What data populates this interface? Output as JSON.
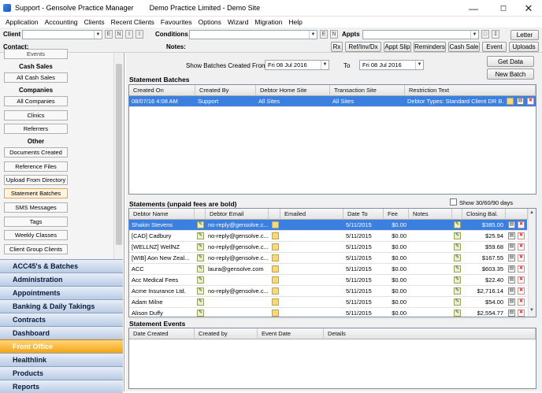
{
  "window": {
    "title": "Support - Gensolve Practice Manager",
    "company": "Demo Practice Limited - Demo Site"
  },
  "menu": [
    "Application",
    "Accounting",
    "Clients",
    "Recent Clients",
    "Favourites",
    "Options",
    "Wizard",
    "Migration",
    "Help"
  ],
  "toolbar": {
    "client_label": "Client",
    "conditions_label": "Conditions",
    "appts_label": "Appts",
    "contact_label": "Contact:",
    "notes_label": "Notes:",
    "letter": "Letter",
    "mini": {
      "e": "E",
      "n": "N",
      "i": "I"
    },
    "buttons": [
      "Rx",
      "Ref/Inv/Dx",
      "Appt Slip",
      "Reminders",
      "Cash Sale",
      "Event",
      "Uploads"
    ]
  },
  "sidebar": {
    "events_label": "Events",
    "cash_sales_head": "Cash Sales",
    "all_cash_sales": "All Cash Sales",
    "companies_head": "Companies",
    "all_companies": "All Companies",
    "clinics": "Clinics",
    "referrers": "Referrers",
    "other_head": "Other",
    "other_items": [
      "Documents Created",
      "Reference Files",
      "Upload From Directory",
      "Statement Batches",
      "SMS Messages",
      "Tags",
      "Weekly Classes",
      "Client Group Clients"
    ],
    "nav": [
      "ACC45's & Batches",
      "Administration",
      "Appointments",
      "Banking & Daily Takings",
      "Contracts",
      "Dashboard",
      "Front Office",
      "Healthlink",
      "Products",
      "Reports"
    ]
  },
  "batches": {
    "show_label": "Show Batches Created From",
    "from": "Fri  08  Jul  2016",
    "to_label": "To",
    "to": "Fri  08  Jul  2016",
    "get_data": "Get Data",
    "new_batch": "New Batch",
    "section": "Statement Batches",
    "headers": [
      "Created On",
      "Created By",
      "Debtor Home Site",
      "Transaction Site",
      "Restriction Text"
    ],
    "row": [
      "08/07/16 4:08 AM",
      "Support",
      "All Sites",
      "All Sites",
      "Debtor Types: Standard Client DR B..."
    ]
  },
  "statements": {
    "section": "Statements (unpaid fees are bold)",
    "show_aging": "Show 30/60/90 days",
    "headers": [
      "Debtor Name",
      "Debtor Email",
      "Emailed",
      "Date To",
      "Fee",
      "Notes",
      "Closing Bal."
    ],
    "rows": [
      {
        "name": "Shakin Stevens",
        "email": "no-reply@gensolve.c...",
        "date": "5/11/2015",
        "fee": "$0.00",
        "bal": "$385.00"
      },
      {
        "name": "[CAD] Cadbury",
        "email": "no-reply@gensolve.c...",
        "date": "5/11/2015",
        "fee": "$0.00",
        "bal": "$25.94"
      },
      {
        "name": "[WELLNZ] WellNZ",
        "email": "no-reply@gensolve.c...",
        "date": "5/11/2015",
        "fee": "$0.00",
        "bal": "$59.68"
      },
      {
        "name": "[WIB] Aon New Zeal...",
        "email": "no-reply@gensolve.c...",
        "date": "5/11/2015",
        "fee": "$0.00",
        "bal": "$167.55"
      },
      {
        "name": "ACC",
        "email": "laura@gensolve.com",
        "date": "5/11/2015",
        "fee": "$0.00",
        "bal": "$603.35"
      },
      {
        "name": "Acc Medical Fees",
        "email": "",
        "date": "5/11/2015",
        "fee": "$0.00",
        "bal": "$22.40"
      },
      {
        "name": "Acme Insurance Ltd.",
        "email": "no-reply@gensolve.c...",
        "date": "5/11/2015",
        "fee": "$0.00",
        "bal": "$2,716.14"
      },
      {
        "name": "Adam Milne",
        "email": "",
        "date": "5/11/2015",
        "fee": "$0.00",
        "bal": "$54.00"
      },
      {
        "name": "Alison Duffy",
        "email": "",
        "date": "5/11/2015",
        "fee": "$0.00",
        "bal": "$2,554.77"
      }
    ]
  },
  "events": {
    "section": "Statement Events",
    "headers": [
      "Date Created",
      "Created by",
      "Event Date",
      "Details"
    ]
  }
}
